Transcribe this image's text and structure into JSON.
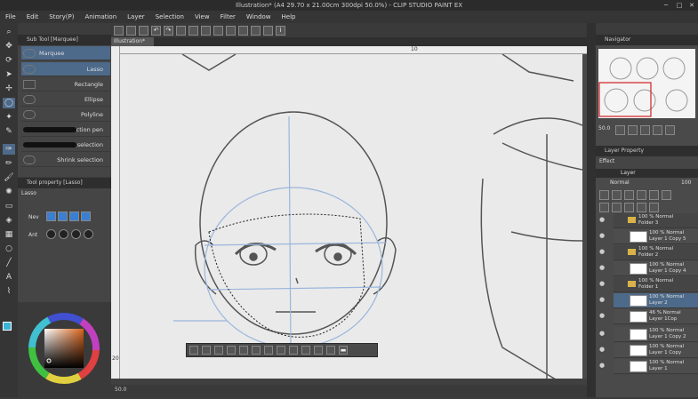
{
  "app": {
    "title": "Illustration* (A4 29.70 x 21.00cm 300dpi 50.0%) - CLIP STUDIO PAINT EX"
  },
  "menu": [
    "File",
    "Edit",
    "Story(P)",
    "Animation",
    "Layer",
    "Selection",
    "View",
    "Filter",
    "Window",
    "Help"
  ],
  "canvas": {
    "tab_label": "Illustration*",
    "ruler_mark_top": "10",
    "ruler_mark_left": "20",
    "zoom": "50.0"
  },
  "subtool": {
    "title": "Sub Tool [Marquee]",
    "group": "Marquee",
    "items": [
      "Lasso",
      "Rectangle",
      "Ellipse",
      "Polyline",
      "Selection pen",
      "Erase selection",
      "Shrink selection"
    ]
  },
  "toolprop": {
    "title": "Tool property [Lasso]",
    "name": "Lasso",
    "mode_label": "Nev",
    "aa_label": "Ant"
  },
  "navigator": {
    "title": "Navigator",
    "zoom": "50.0"
  },
  "layerprop": {
    "title": "Layer Property",
    "effect": "Effect"
  },
  "layers": {
    "tab": "Layer",
    "blend": "Normal",
    "opacity": "100",
    "items": [
      {
        "name": "100 % Normal",
        "sub": "Folder 3",
        "type": "folder"
      },
      {
        "name": "100 % Normal",
        "sub": "Layer 1 Copy 5",
        "type": "layer"
      },
      {
        "name": "100 % Normal",
        "sub": "Folder 2",
        "type": "folder"
      },
      {
        "name": "100 % Normal",
        "sub": "Layer 1 Copy 4",
        "type": "layer"
      },
      {
        "name": "100 % Normal",
        "sub": "Folder 1",
        "type": "folder"
      },
      {
        "name": "100 % Normal",
        "sub": "Layer 2",
        "type": "layer",
        "selected": true
      },
      {
        "name": "46 % Normal",
        "sub": "Layer 1Cop",
        "type": "layer"
      },
      {
        "name": "100 % Normal",
        "sub": "Layer 1 Copy 2",
        "type": "layer"
      },
      {
        "name": "100 % Normal",
        "sub": "Layer 1 Copy",
        "type": "layer"
      },
      {
        "name": "100 % Normal",
        "sub": "Layer 1",
        "type": "layer"
      }
    ]
  },
  "colors": {
    "accent": "#4d6a8a",
    "main_color": "#3cb4d8"
  }
}
